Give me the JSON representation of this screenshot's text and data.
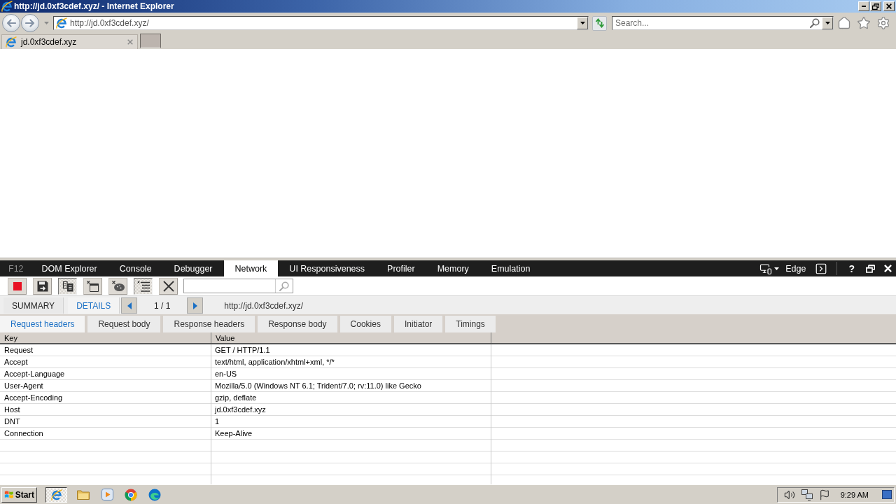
{
  "window": {
    "title": "http://jd.0xf3cdef.xyz/ - Internet Explorer"
  },
  "address_bar": {
    "url": "http://jd.0xf3cdef.xyz/"
  },
  "search": {
    "placeholder": "Search..."
  },
  "browser_tabs": [
    {
      "label": "jd.0xf3cdef.xyz",
      "selected": true
    }
  ],
  "devtools": {
    "label": "F12",
    "tabs": [
      {
        "label": "DOM Explorer",
        "selected": false
      },
      {
        "label": "Console",
        "selected": false
      },
      {
        "label": "Debugger",
        "selected": false
      },
      {
        "label": "Network",
        "selected": true
      },
      {
        "label": "UI Responsiveness",
        "selected": false
      },
      {
        "label": "Profiler",
        "selected": false
      },
      {
        "label": "Memory",
        "selected": false
      },
      {
        "label": "Emulation",
        "selected": false
      }
    ],
    "document_mode": "Edge",
    "help": "?"
  },
  "network_toolbar": {
    "buttons": [
      {
        "kind": "stop",
        "pressed": false
      },
      {
        "kind": "save",
        "pressed": false
      },
      {
        "kind": "refresh",
        "pressed": true
      },
      {
        "kind": "cache",
        "pressed": false
      },
      {
        "kind": "cookies",
        "pressed": false
      },
      {
        "kind": "list",
        "pressed": true
      },
      {
        "kind": "clear",
        "pressed": false
      }
    ]
  },
  "request_nav": {
    "views": [
      {
        "label": "SUMMARY",
        "selected": false
      },
      {
        "label": "DETAILS",
        "selected": true
      }
    ],
    "counter": "1 / 1",
    "url": "http://jd.0xf3cdef.xyz/"
  },
  "detail_tabs": [
    {
      "label": "Request headers",
      "selected": true
    },
    {
      "label": "Request body",
      "selected": false
    },
    {
      "label": "Response headers",
      "selected": false
    },
    {
      "label": "Response body",
      "selected": false
    },
    {
      "label": "Cookies",
      "selected": false
    },
    {
      "label": "Initiator",
      "selected": false
    },
    {
      "label": "Timings",
      "selected": false
    }
  ],
  "table": {
    "columns": [
      "Key",
      "Value"
    ],
    "rows": [
      {
        "key": "Request",
        "value": "GET / HTTP/1.1"
      },
      {
        "key": "Accept",
        "value": "text/html, application/xhtml+xml, */*"
      },
      {
        "key": "Accept-Language",
        "value": "en-US"
      },
      {
        "key": "User-Agent",
        "value": "Mozilla/5.0 (Windows NT 6.1; Trident/7.0; rv:11.0) like Gecko"
      },
      {
        "key": "Accept-Encoding",
        "value": "gzip, deflate"
      },
      {
        "key": "Host",
        "value": "jd.0xf3cdef.xyz"
      },
      {
        "key": "DNT",
        "value": "1"
      },
      {
        "key": "Connection",
        "value": "Keep-Alive"
      }
    ]
  },
  "taskbar": {
    "start": "Start",
    "apps": [
      {
        "kind": "ie",
        "selected": true
      },
      {
        "kind": "folder",
        "selected": false
      },
      {
        "kind": "media",
        "selected": false
      },
      {
        "kind": "chrome",
        "selected": false
      },
      {
        "kind": "edge",
        "selected": false
      }
    ],
    "clock": "9:29 AM"
  }
}
